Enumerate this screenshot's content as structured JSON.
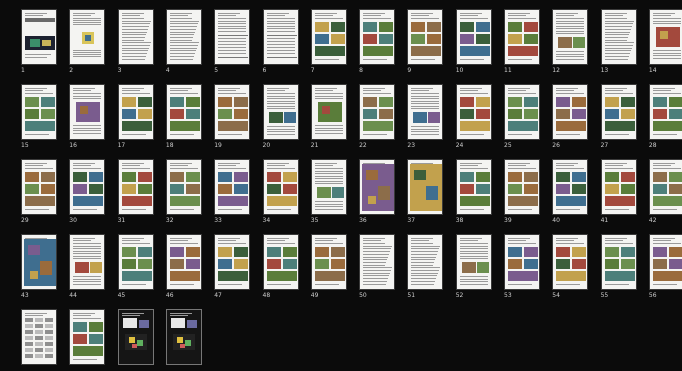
{
  "view": "page-thumbnail-grid",
  "pages": [
    {
      "label": "1",
      "style": "title-dark"
    },
    {
      "label": "2",
      "style": "diagram"
    },
    {
      "label": "3",
      "style": "text"
    },
    {
      "label": "4",
      "style": "text"
    },
    {
      "label": "5",
      "style": "text-table"
    },
    {
      "label": "6",
      "style": "text-table"
    },
    {
      "label": "7",
      "style": "photos"
    },
    {
      "label": "8",
      "style": "photos"
    },
    {
      "label": "9",
      "style": "photos"
    },
    {
      "label": "10",
      "style": "photos"
    },
    {
      "label": "11",
      "style": "photos"
    },
    {
      "label": "12",
      "style": "text-figure"
    },
    {
      "label": "13",
      "style": "text"
    },
    {
      "label": "14",
      "style": "figure"
    },
    {
      "label": "15",
      "style": "photos"
    },
    {
      "label": "16",
      "style": "figure"
    },
    {
      "label": "17",
      "style": "photos"
    },
    {
      "label": "18",
      "style": "photos"
    },
    {
      "label": "19",
      "style": "photos"
    },
    {
      "label": "20",
      "style": "text-figure"
    },
    {
      "label": "21",
      "style": "figure"
    },
    {
      "label": "22",
      "style": "photos"
    },
    {
      "label": "23",
      "style": "text-figure"
    },
    {
      "label": "24",
      "style": "photos"
    },
    {
      "label": "25",
      "style": "photos"
    },
    {
      "label": "26",
      "style": "photos"
    },
    {
      "label": "27",
      "style": "photos"
    },
    {
      "label": "28",
      "style": "photos"
    },
    {
      "label": "29",
      "style": "photos"
    },
    {
      "label": "30",
      "style": "photos"
    },
    {
      "label": "31",
      "style": "photos"
    },
    {
      "label": "32",
      "style": "photos"
    },
    {
      "label": "33",
      "style": "photos"
    },
    {
      "label": "34",
      "style": "photos"
    },
    {
      "label": "35",
      "style": "text-figure"
    },
    {
      "label": "36",
      "style": "map-full"
    },
    {
      "label": "37",
      "style": "map-full"
    },
    {
      "label": "38",
      "style": "photos"
    },
    {
      "label": "39",
      "style": "photos"
    },
    {
      "label": "40",
      "style": "photos"
    },
    {
      "label": "41",
      "style": "photos"
    },
    {
      "label": "42",
      "style": "photos"
    },
    {
      "label": "43",
      "style": "map-full"
    },
    {
      "label": "44",
      "style": "text-figure"
    },
    {
      "label": "45",
      "style": "photos"
    },
    {
      "label": "46",
      "style": "photos"
    },
    {
      "label": "47",
      "style": "photos"
    },
    {
      "label": "48",
      "style": "photos"
    },
    {
      "label": "49",
      "style": "photos"
    },
    {
      "label": "50",
      "style": "text"
    },
    {
      "label": "51",
      "style": "text"
    },
    {
      "label": "52",
      "style": "text-figure"
    },
    {
      "label": "53",
      "style": "photos"
    },
    {
      "label": "54",
      "style": "photos"
    },
    {
      "label": "55",
      "style": "photos"
    },
    {
      "label": "56",
      "style": "photos"
    },
    {
      "label": "",
      "style": "table"
    },
    {
      "label": "",
      "style": "photos"
    },
    {
      "label": "",
      "style": "dark-figure"
    },
    {
      "label": "",
      "style": "dark-figure"
    }
  ],
  "colors": {
    "background": "#0b0b0b",
    "page": "#f4f4f2",
    "label": "#cfcfcf"
  }
}
